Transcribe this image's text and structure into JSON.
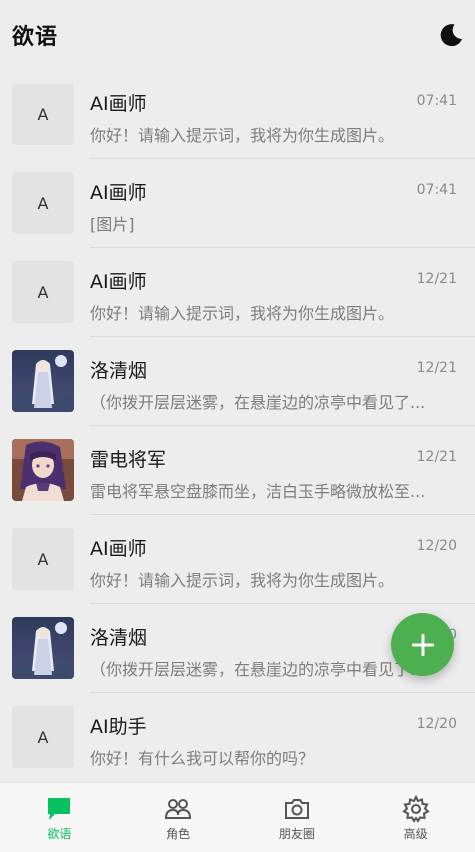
{
  "header": {
    "title": "欲语",
    "theme_icon": "moon-icon"
  },
  "chats": [
    {
      "name": "AI画师",
      "time": "07:41",
      "message": "你好！请输入提示词，我将为你生成图片。",
      "avatar": "A",
      "avatar_type": "letter"
    },
    {
      "name": "AI画师",
      "time": "07:41",
      "message": "[图片]",
      "avatar": "A",
      "avatar_type": "letter"
    },
    {
      "name": "AI画师",
      "time": "12/21",
      "message": "你好！请输入提示词，我将为你生成图片。",
      "avatar": "A",
      "avatar_type": "letter"
    },
    {
      "name": "洛清烟",
      "time": "12/21",
      "message": "（你拨开层层迷雾，在悬崖边的凉亭中看见了...",
      "avatar_type": "image-white-haired"
    },
    {
      "name": "雷电将军",
      "time": "12/21",
      "message": "雷电将军悬空盘膝而坐，洁白玉手略微放松至...",
      "avatar_type": "image-purple-haired"
    },
    {
      "name": "AI画师",
      "time": "12/20",
      "message": "你好！请输入提示词，我将为你生成图片。",
      "avatar": "A",
      "avatar_type": "letter"
    },
    {
      "name": "洛清烟",
      "time": "12/20",
      "message": "（你拨开层层迷雾，在悬崖边的凉亭中看见了...",
      "avatar_type": "image-white-haired"
    },
    {
      "name": "AI助手",
      "time": "12/20",
      "message": "你好！有什么我可以帮你的吗？",
      "avatar": "A",
      "avatar_type": "letter"
    }
  ],
  "fab": {
    "icon": "plus-icon",
    "color": "#4caf50"
  },
  "bottom_nav": [
    {
      "label": "欲语",
      "icon": "chat-bubble-icon",
      "active": true
    },
    {
      "label": "角色",
      "icon": "people-icon",
      "active": false
    },
    {
      "label": "朋友圈",
      "icon": "camera-icon",
      "active": false
    },
    {
      "label": "高级",
      "icon": "gear-icon",
      "active": false
    }
  ],
  "colors": {
    "accent": "#07c160",
    "background": "#ededed"
  }
}
